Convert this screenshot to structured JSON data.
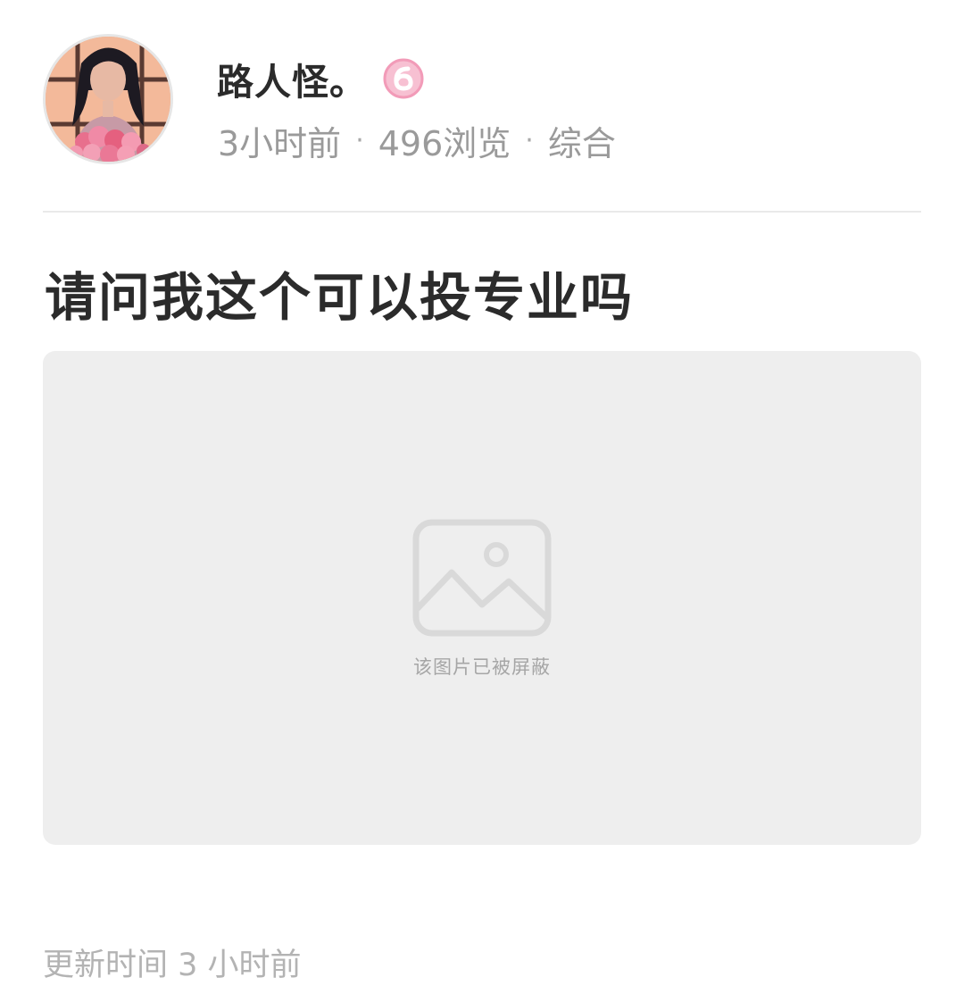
{
  "post": {
    "author": {
      "name": "路人怪。",
      "level_badge_icon": "level-6-badge-icon",
      "avatar_icon": "anime-girl-with-flowers-avatar"
    },
    "meta": {
      "time": "3小时前",
      "views": "496浏览",
      "category": "综合",
      "separator": "·"
    },
    "title": "请问我这个可以投专业吗",
    "image": {
      "icon": "image-placeholder-icon",
      "blocked_text": "该图片已被屏蔽"
    },
    "updated_text": "更新时间 3 小时前"
  },
  "colors": {
    "badge_pink": "#f29bb8",
    "meta_gray": "#9a9a9a",
    "image_bg": "#eeeeee"
  }
}
